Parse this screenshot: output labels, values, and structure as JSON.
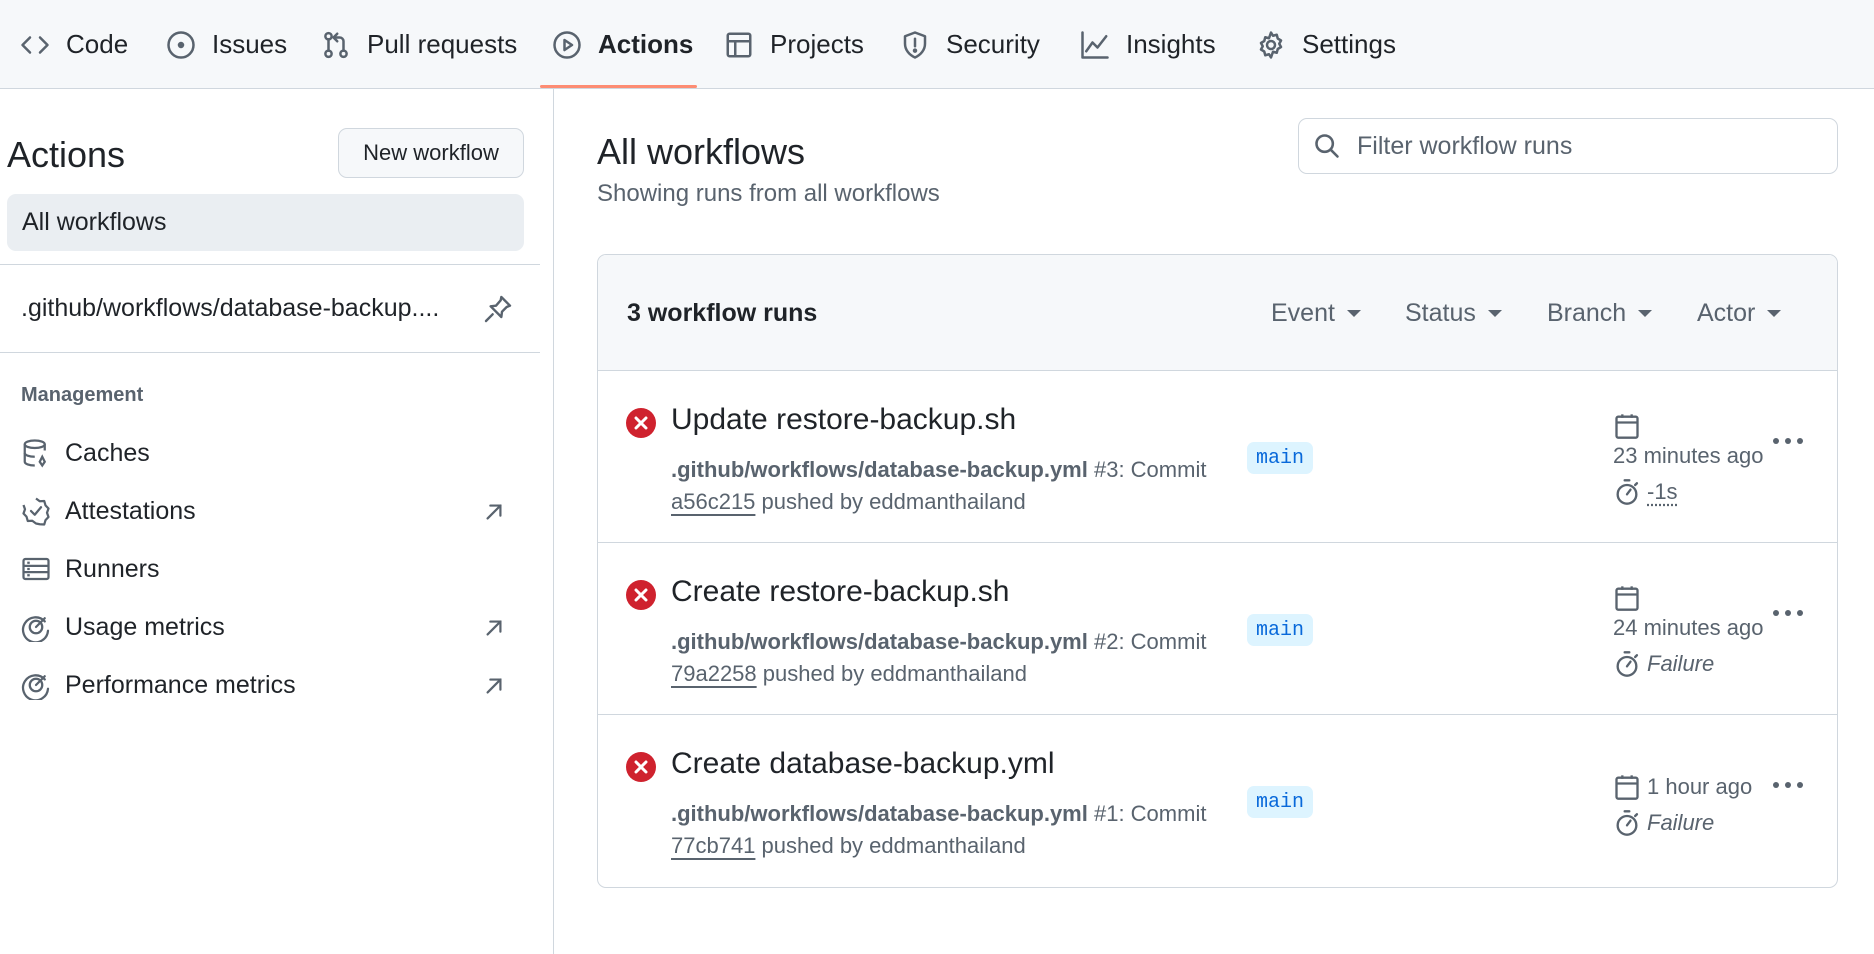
{
  "nav": {
    "tabs": [
      {
        "label": "Code",
        "icon": "code-icon"
      },
      {
        "label": "Issues",
        "icon": "issue-opened-icon"
      },
      {
        "label": "Pull requests",
        "icon": "git-pull-request-icon"
      },
      {
        "label": "Actions",
        "icon": "play-icon",
        "selected": true
      },
      {
        "label": "Projects",
        "icon": "table-icon"
      },
      {
        "label": "Security",
        "icon": "shield-icon"
      },
      {
        "label": "Insights",
        "icon": "graph-icon"
      },
      {
        "label": "Settings",
        "icon": "gear-icon"
      }
    ],
    "accent_color": "#fd8c73"
  },
  "sidebar": {
    "title": "Actions",
    "new_workflow_label": "New workflow",
    "all_workflows_label": "All workflows",
    "workflows": [
      {
        "label": ".github/workflows/database-backup...."
      }
    ],
    "management_label": "Management",
    "management_items": [
      {
        "label": "Caches",
        "icon": "database-icon",
        "external": false
      },
      {
        "label": "Attestations",
        "icon": "verified-icon",
        "external": true
      },
      {
        "label": "Runners",
        "icon": "server-icon",
        "external": false
      },
      {
        "label": "Usage metrics",
        "icon": "meter-icon",
        "external": true
      },
      {
        "label": "Performance metrics",
        "icon": "meter-icon",
        "external": true
      }
    ]
  },
  "main": {
    "title": "All workflows",
    "subtitle": "Showing runs from all workflows",
    "filter_placeholder": "Filter workflow runs",
    "runs_count": "3 workflow runs",
    "filters": [
      "Event",
      "Status",
      "Branch",
      "Actor"
    ],
    "runs": [
      {
        "status": "failure",
        "title": "Update restore-backup.sh",
        "workflow": ".github/workflows/database-backup.yml",
        "run_desc": " #3: Commit",
        "sha": "a56c215",
        "pushed_by": " pushed by eddmanthailand",
        "branch": "main",
        "time": "23 minutes ago",
        "duration": "-1s",
        "duration_style": "dotted"
      },
      {
        "status": "failure",
        "title": "Create restore-backup.sh",
        "workflow": ".github/workflows/database-backup.yml",
        "run_desc": " #2: Commit",
        "sha": "79a2258",
        "pushed_by": " pushed by eddmanthailand",
        "branch": "main",
        "time": "24 minutes ago",
        "duration": "Failure",
        "duration_style": "italic"
      },
      {
        "status": "failure",
        "title": "Create database-backup.yml",
        "workflow": ".github/workflows/database-backup.yml",
        "run_desc": " #1: Commit",
        "sha": "77cb741",
        "pushed_by": " pushed by eddmanthailand",
        "branch": "main",
        "time": "1 hour ago",
        "duration": "Failure",
        "duration_style": "italic"
      }
    ],
    "failure_color": "#cf222e",
    "branch_color": "#0969da"
  }
}
